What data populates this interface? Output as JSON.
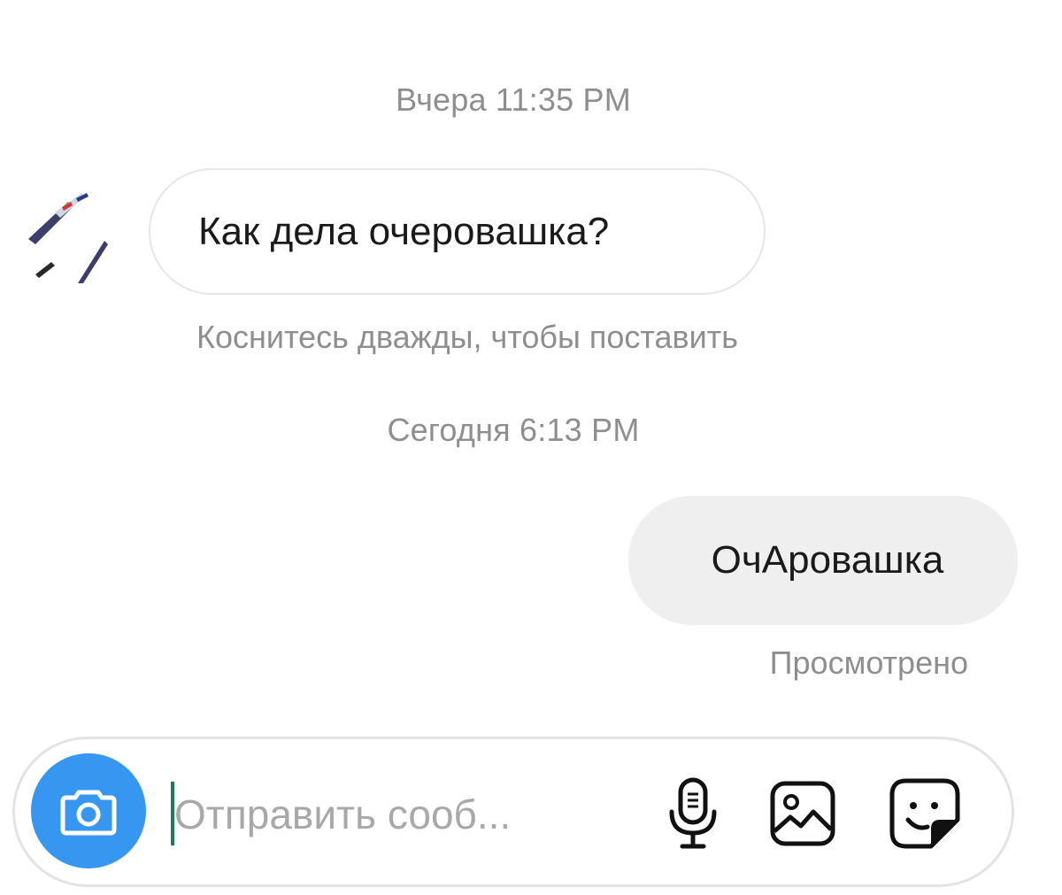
{
  "thread": {
    "timestamp_1": "Вчера 11:35 PM",
    "incoming_message": "Как дела очеровашка?",
    "double_tap_hint": "Коснитесь дважды, чтобы поставить",
    "timestamp_2": "Сегодня 6:13 PM",
    "outgoing_message": "ОчАровашка",
    "seen_status": "Просмотрено"
  },
  "composer": {
    "placeholder": "Отправить сооб...",
    "value": ""
  },
  "icons": {
    "camera": "camera-icon",
    "mic": "microphone-icon",
    "gallery": "image-icon",
    "sticker": "sticker-icon"
  },
  "colors": {
    "accent": "#3797f0",
    "muted_text": "#8e8e8e",
    "outgoing_bubble": "#efefef",
    "bubble_border": "#e6e6e6"
  }
}
